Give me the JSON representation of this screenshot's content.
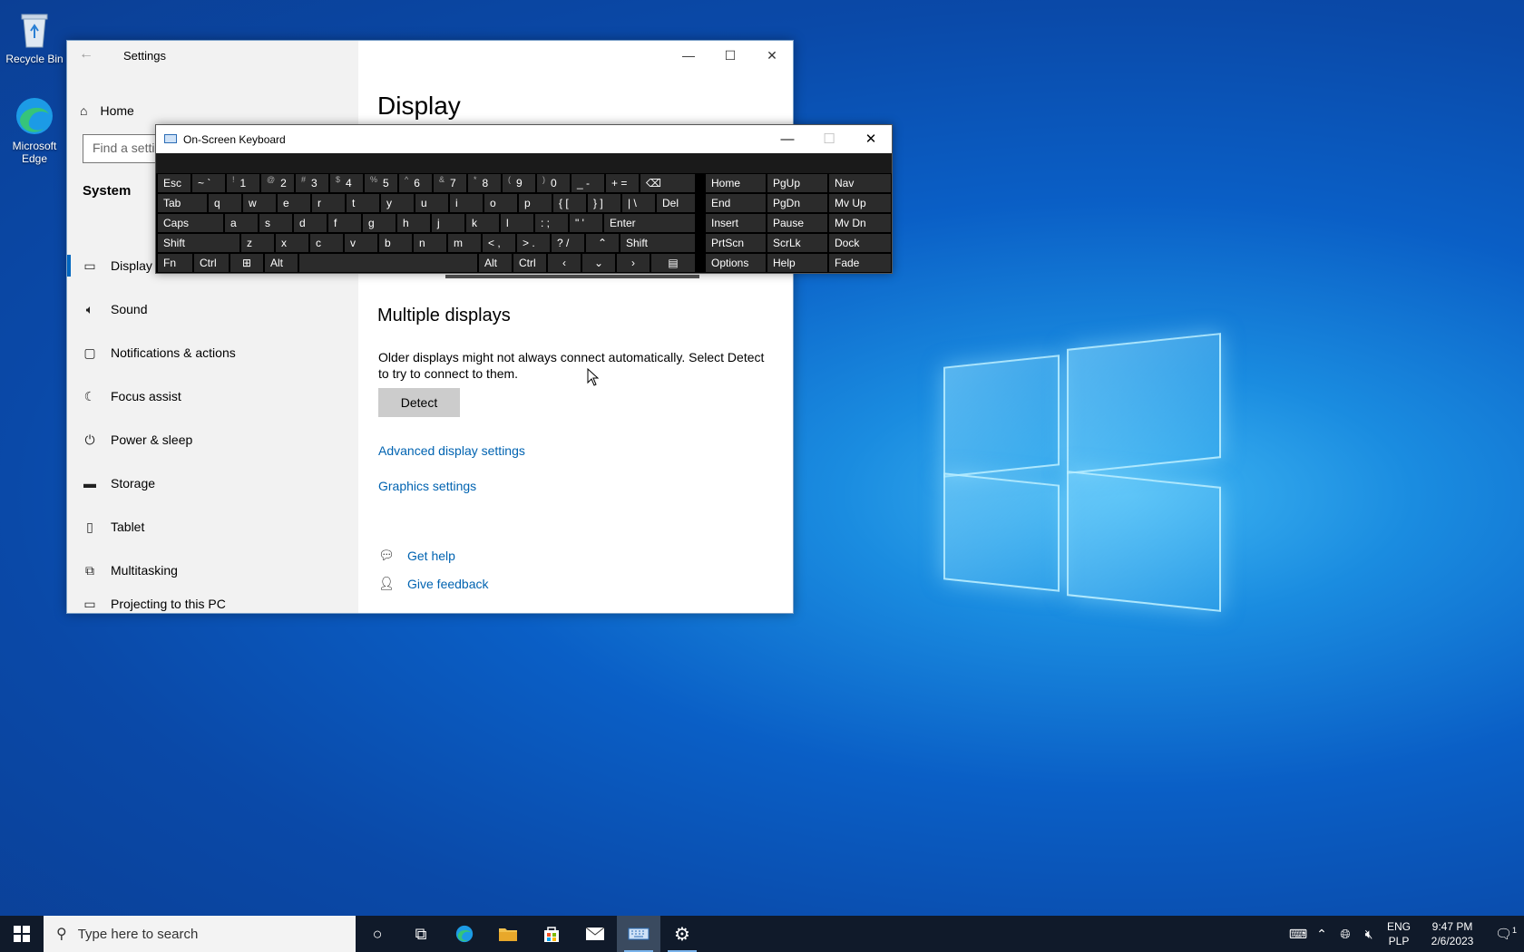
{
  "desktop": {
    "icons": [
      {
        "label": "Recycle Bin"
      },
      {
        "label": "Microsoft Edge"
      }
    ]
  },
  "settings": {
    "title": "Settings",
    "home_label": "Home",
    "search_placeholder": "Find a setting",
    "section": "System",
    "nav": [
      {
        "label": "Display",
        "icon": "monitor-icon"
      },
      {
        "label": "Sound",
        "icon": "speaker-icon"
      },
      {
        "label": "Notifications & actions",
        "icon": "message-icon"
      },
      {
        "label": "Focus assist",
        "icon": "moon-icon"
      },
      {
        "label": "Power & sleep",
        "icon": "power-icon"
      },
      {
        "label": "Storage",
        "icon": "drive-icon"
      },
      {
        "label": "Tablet",
        "icon": "tablet-icon"
      },
      {
        "label": "Multitasking",
        "icon": "multitask-icon"
      },
      {
        "label": "Projecting to this PC",
        "icon": "projector-icon"
      }
    ],
    "page_title": "Display",
    "multiple_heading": "Multiple displays",
    "multiple_text": "Older displays might not always connect automatically. Select Detect to try to connect to them.",
    "detect_label": "Detect",
    "advanced_link": "Advanced display settings",
    "graphics_link": "Graphics settings",
    "get_help": "Get help",
    "give_feedback": "Give feedback"
  },
  "osk": {
    "title": "On-Screen Keyboard",
    "keys": {
      "esc": "Esc",
      "tilde": "~ `",
      "k1s": "!",
      "k1": "1",
      "k2s": "@",
      "k2": "2",
      "k3s": "#",
      "k3": "3",
      "k4s": "$",
      "k4": "4",
      "k5s": "%",
      "k5": "5",
      "k6s": "^",
      "k6": "6",
      "k7s": "&",
      "k7": "7",
      "k8s": "*",
      "k8": "8",
      "k9s": "(",
      "k9": "9",
      "k0s": ")",
      "k0": "0",
      "minus": "_ -",
      "equals": "+ =",
      "bksp": "⌫",
      "home": "Home",
      "pgup": "PgUp",
      "nav": "Nav",
      "tab": "Tab",
      "q": "q",
      "w": "w",
      "e": "e",
      "r": "r",
      "t": "t",
      "y": "y",
      "u": "u",
      "i": "i",
      "o": "o",
      "p": "p",
      "lbr": "{ [",
      "rbr": "} ]",
      "bsl": "| \\",
      "del": "Del",
      "end": "End",
      "pgdn": "PgDn",
      "mvup": "Mv Up",
      "caps": "Caps",
      "a": "a",
      "s": "s",
      "d": "d",
      "f": "f",
      "g": "g",
      "h": "h",
      "j": "j",
      "k": "k",
      "l": "l",
      "semi": ": ;",
      "quote": "\" '",
      "enter": "Enter",
      "insert": "Insert",
      "pause": "Pause",
      "mvdn": "Mv Dn",
      "lshift": "Shift",
      "z": "z",
      "x": "x",
      "c": "c",
      "v": "v",
      "b": "b",
      "n": "n",
      "m": "m",
      "comma": "< ,",
      "period": "> .",
      "slash": "? /",
      "up": "⌃",
      "rshift": "Shift",
      "prtscn": "PrtScn",
      "scrlk": "ScrLk",
      "dock": "Dock",
      "fn": "Fn",
      "lctrl": "Ctrl",
      "win": "⊞",
      "lalt": "Alt",
      "ralt": "Alt",
      "rctrl": "Ctrl",
      "left": "‹",
      "down": "⌄",
      "right": "›",
      "menu": "▤",
      "options": "Options",
      "help": "Help",
      "fade": "Fade"
    }
  },
  "taskbar": {
    "search_placeholder": "Type here to search",
    "lang_top": "ENG",
    "lang_bottom": "PLP",
    "time": "9:47 PM",
    "date": "2/6/2023",
    "notif_count": "1"
  }
}
